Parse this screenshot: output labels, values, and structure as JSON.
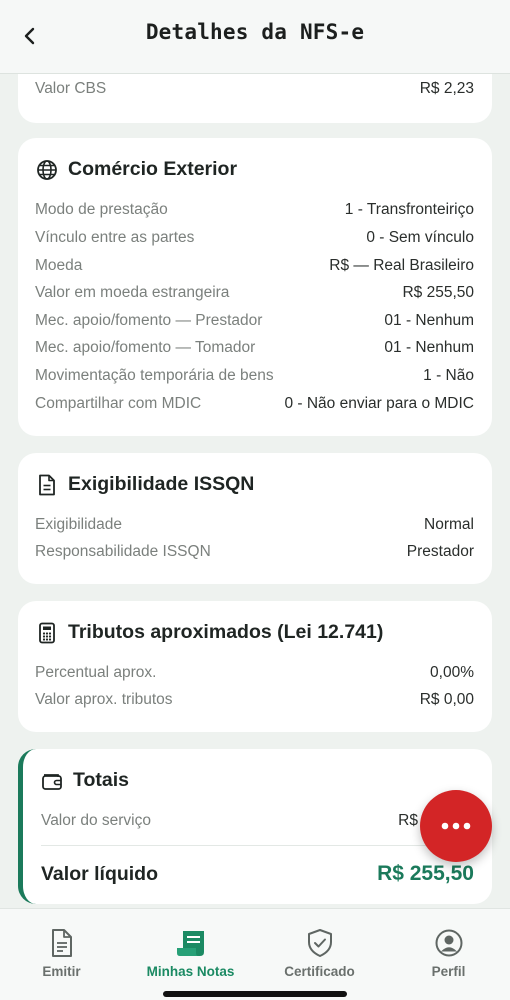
{
  "header": {
    "title": "Detalhes da NFS-e"
  },
  "top_partial": {
    "label": "Valor CBS",
    "value": "R$ 2,23"
  },
  "comercio": {
    "title": "Comércio Exterior",
    "rows": [
      {
        "label": "Modo de prestação",
        "value": "1 - Transfronteiriço"
      },
      {
        "label": "Vínculo entre as partes",
        "value": "0 - Sem vínculo"
      },
      {
        "label": "Moeda",
        "value": "R$ — Real Brasileiro"
      },
      {
        "label": "Valor em moeda estrangeira",
        "value": "R$ 255,50"
      },
      {
        "label": "Mec. apoio/fomento — Prestador",
        "value": "01 - Nenhum"
      },
      {
        "label": "Mec. apoio/fomento — Tomador",
        "value": "01 - Nenhum"
      },
      {
        "label": "Movimentação temporária de bens",
        "value": "1 - Não"
      },
      {
        "label": "Compartilhar com MDIC",
        "value": "0 - Não enviar para o MDIC"
      }
    ]
  },
  "exigibilidade": {
    "title": "Exigibilidade ISSQN",
    "rows": [
      {
        "label": "Exigibilidade",
        "value": "Normal"
      },
      {
        "label": "Responsabilidade ISSQN",
        "value": "Prestador"
      }
    ]
  },
  "tributos": {
    "title": "Tributos aproximados (Lei 12.741)",
    "rows": [
      {
        "label": "Percentual aprox.",
        "value": "0,00%"
      },
      {
        "label": "Valor aprox. tributos",
        "value": "R$ 0,00"
      }
    ]
  },
  "totais": {
    "title": "Totais",
    "servico_label": "Valor do serviço",
    "servico_value": "R$",
    "liquido_label": "Valor líquido",
    "liquido_value": "R$ 255,50"
  },
  "tabs": [
    {
      "label": "Emitir",
      "icon": "document-edit-icon"
    },
    {
      "label": "Minhas Notas",
      "icon": "notes-icon",
      "active": true
    },
    {
      "label": "Certificado",
      "icon": "shield-check-icon"
    },
    {
      "label": "Perfil",
      "icon": "user-circle-icon"
    }
  ],
  "colors": {
    "accent": "#1b8a63",
    "fab": "#d32526",
    "background": "#eef2ef"
  }
}
